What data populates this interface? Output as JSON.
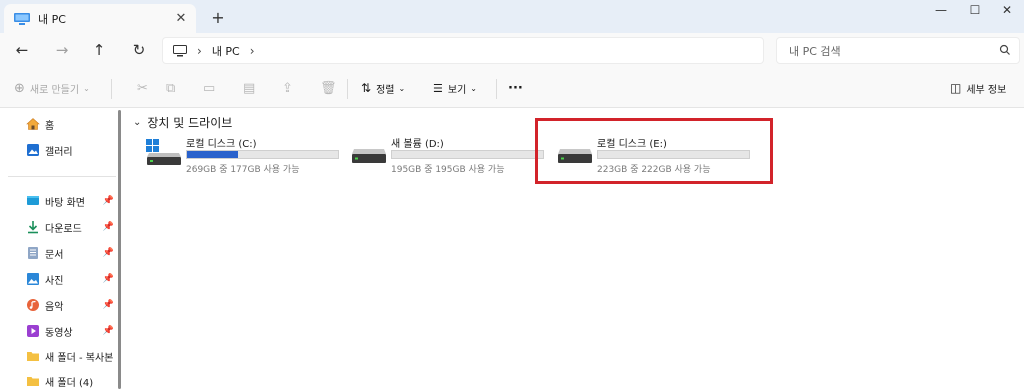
{
  "tab": {
    "title": "내 PC",
    "close": "✕"
  },
  "window": {
    "newtab": "+",
    "minimize": "—",
    "maximize": "☐",
    "close": "✕"
  },
  "nav": {
    "back": "←",
    "forward": "→",
    "up": "↑",
    "refresh": "↻"
  },
  "address": {
    "crumb": "내 PC"
  },
  "search": {
    "placeholder": "내 PC 검색"
  },
  "commands": {
    "new": "새로 만들기",
    "sort": "정렬",
    "view": "보기",
    "more": "···",
    "details": "세부 정보"
  },
  "sidebar": {
    "items": [
      {
        "label": "홈",
        "icon": "home-icon"
      },
      {
        "label": "갤러리",
        "icon": "gallery-icon"
      },
      {
        "label": "바탕 화면",
        "icon": "desktop-icon",
        "pinned": true
      },
      {
        "label": "다운로드",
        "icon": "download-icon",
        "pinned": true
      },
      {
        "label": "문서",
        "icon": "document-icon",
        "pinned": true
      },
      {
        "label": "사진",
        "icon": "pictures-icon",
        "pinned": true
      },
      {
        "label": "음악",
        "icon": "music-icon",
        "pinned": true
      },
      {
        "label": "동영상",
        "icon": "video-icon",
        "pinned": true
      },
      {
        "label": "새 폴더 - 복사본",
        "icon": "folder-icon"
      },
      {
        "label": "새 폴더 (4)",
        "icon": "folder-icon"
      }
    ]
  },
  "content": {
    "group_title": "장치 및 드라이브",
    "drives": [
      {
        "name": "로컬 디스크 (C:)",
        "info": "269GB 중 177GB 사용 가능",
        "used_fraction": 0.34,
        "windows": true
      },
      {
        "name": "새 볼륨 (D:)",
        "info": "195GB 중 195GB 사용 가능",
        "used_fraction": 0.0
      },
      {
        "name": "로컬 디스크 (E:)",
        "info": "223GB 중 222GB 사용 가능",
        "used_fraction": 0.0
      }
    ]
  },
  "colors": {
    "accent": "#2a62cc",
    "highlight": "#d2232a",
    "titlebar": "#e7eef7"
  }
}
